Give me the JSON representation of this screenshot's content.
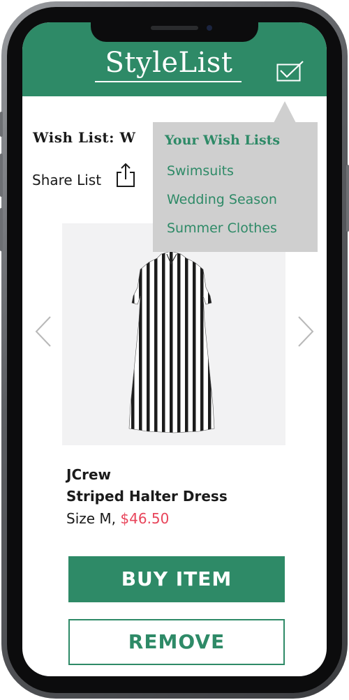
{
  "app": {
    "logo": "StyleList"
  },
  "wishlist": {
    "title": "Wish List: W",
    "share_label": "Share List"
  },
  "dropdown": {
    "title": "Your Wish Lists",
    "items": [
      "Swimsuits",
      "Wedding Season",
      "Summer Clothes"
    ]
  },
  "product": {
    "brand": "JCrew",
    "name": "Striped Halter Dress",
    "size": "Size M,",
    "price": "$46.50"
  },
  "actions": {
    "buy_label": "BUY ITEM",
    "remove_label": "REMOVE"
  },
  "colors": {
    "accent": "#2e8a67",
    "price": "#e8445a",
    "dropdown_bg": "#cfcfcf"
  },
  "icons": {
    "header": "checkbox-check-icon",
    "share": "share-upload-icon",
    "prev": "chevron-left-icon",
    "next": "chevron-right-icon"
  }
}
